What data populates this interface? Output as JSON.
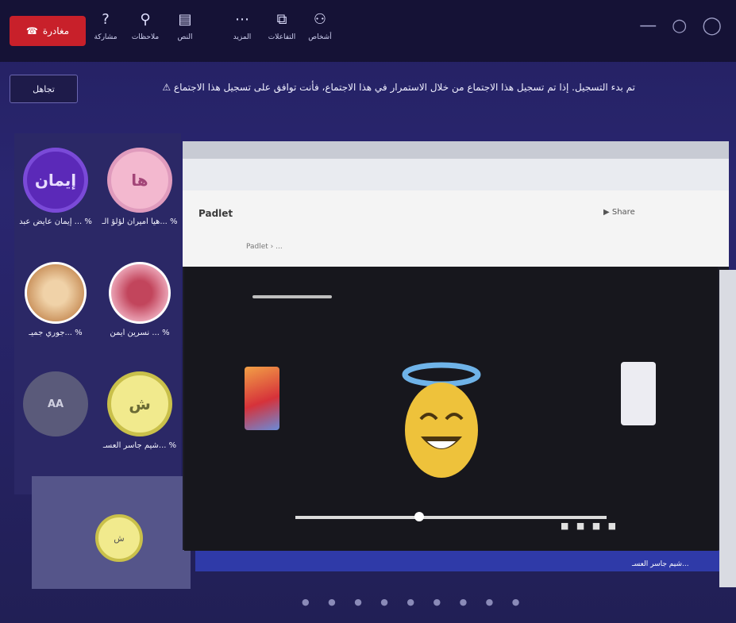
{
  "toolbar": {
    "leave_label": "مغادرة",
    "tools": [
      {
        "icon": "question-mark-icon",
        "glyph": "?",
        "label": "مشاركة"
      },
      {
        "icon": "person-icon",
        "glyph": "⚲",
        "label": "ملاحظات"
      },
      {
        "icon": "notebook-icon",
        "glyph": "▤",
        "label": "النص"
      },
      {
        "icon": "more-icon",
        "glyph": "⋯",
        "label": "المزيد"
      },
      {
        "icon": "share-icon",
        "glyph": "⧉",
        "label": "التفاعلات"
      },
      {
        "icon": "people-icon",
        "glyph": "⚇",
        "label": "أشخاص"
      }
    ],
    "window_controls": "— ○ ◯"
  },
  "notice": {
    "button_label": "تجاهل",
    "text": "⚠ تم بدء التسجيل. إذا تم تسجيل هذا الاجتماع من خلال الاستمرار في هذا الاجتماع، فأنت توافق على تسجيل هذا الاجتماع"
  },
  "participants": [
    {
      "initials": "ها",
      "name": "هيا أميران لؤلؤ الـ... %",
      "color": "#f3b8cf",
      "border": "#e09bbd",
      "text_color": "#a34578"
    },
    {
      "initials": "إيمان",
      "name": "إيمان عايض عبد ... %",
      "color": "#5b29b8",
      "border": "#7a4ad8",
      "text_color": "#e7dcff"
    },
    {
      "initials": "",
      "name": "نسرين أيمن ...  %",
      "color": "#d97b93",
      "border": "#ffffff",
      "text_color": "#ffffff"
    },
    {
      "initials": "",
      "name": "جوري جميـ... %",
      "color": "#e0b27b",
      "border": "#ffffff",
      "text_color": "#ffffff"
    },
    {
      "initials": "ش",
      "name": "شيم جاسر العسـ... %",
      "color": "#f1ea8d",
      "border": "#c9c04a",
      "text_color": "#6b6b35"
    },
    {
      "initials": "AA",
      "name": "",
      "color": "#5a5a7a",
      "border": "#5a5a7a",
      "text_color": "#d0d0e0"
    }
  ],
  "self_view": {
    "initials": "ش"
  },
  "screen_share": {
    "site_name": "Padlet",
    "site_right": "▶ Share",
    "breadcrumb": "Padlet › ...",
    "controls": "■ ■ ■ ■"
  },
  "taskbar": {
    "label": "شيم جاسر العسـ..."
  },
  "pager": "● ● ● ● ● ● ● ● ●",
  "colors": {
    "accent": "#c8202a",
    "background": "#232060",
    "taskbar": "#2f3aa8"
  }
}
